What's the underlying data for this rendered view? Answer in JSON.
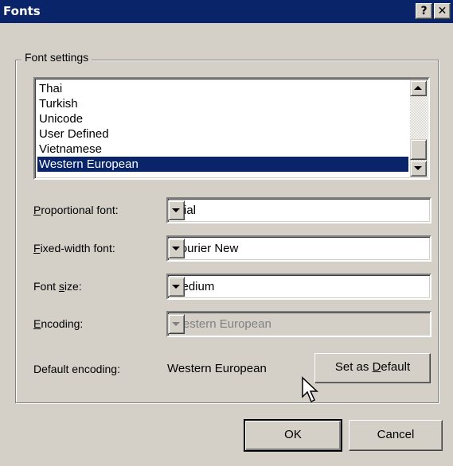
{
  "window": {
    "title": "Fonts",
    "help_glyph": "?",
    "close_glyph": "✕",
    "help_icon": "question-mark",
    "close_icon": "close-x"
  },
  "group": {
    "label": "Font settings"
  },
  "character_sets": {
    "items": [
      "Thai",
      "Turkish",
      "Unicode",
      "User Defined",
      "Vietnamese",
      "Western European"
    ],
    "selected": "Western European"
  },
  "fields": {
    "proportional": {
      "label_u": "P",
      "label_rest": "roportional font:",
      "value": "Arial"
    },
    "fixed": {
      "label_u": "F",
      "label_rest": "ixed-width font:",
      "value": "Courier New"
    },
    "size": {
      "label_pre": "Font ",
      "label_u": "s",
      "label_rest": "ize:",
      "value": "Medium"
    },
    "encoding": {
      "label_u": "E",
      "label_rest": "ncoding:",
      "value": "Western European",
      "disabled": true
    }
  },
  "default_encoding": {
    "label": "Default encoding:",
    "value": "Western European",
    "button_pre": "Set as ",
    "button_u": "D",
    "button_rest": "efault"
  },
  "buttons": {
    "ok": "OK",
    "cancel": "Cancel"
  },
  "colors": {
    "face": "#d4d0c8",
    "title_bar": "#0a246a",
    "selection": "#0a246a"
  }
}
